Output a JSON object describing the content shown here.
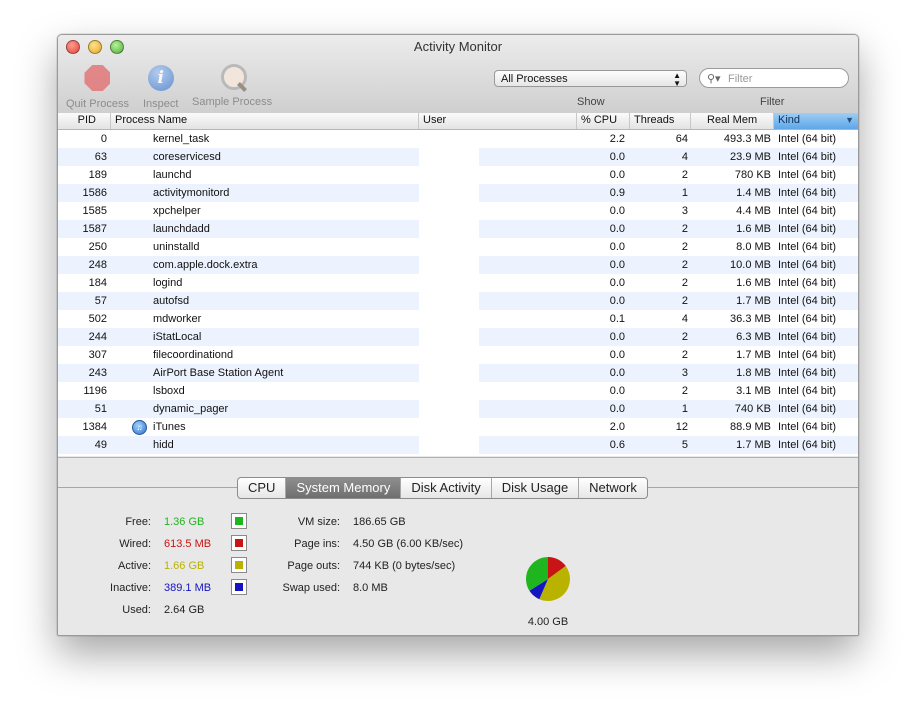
{
  "window": {
    "title": "Activity Monitor"
  },
  "toolbar": {
    "quit_label": "Quit Process",
    "inspect_label": "Inspect",
    "sample_label": "Sample Process",
    "show_select_value": "All Processes",
    "show_label": "Show",
    "filter_placeholder": "Filter",
    "filter_label": "Filter"
  },
  "columns": {
    "pid": "PID",
    "name": "Process Name",
    "user": "User",
    "cpu": "% CPU",
    "threads": "Threads",
    "mem": "Real Mem",
    "kind": "Kind"
  },
  "processes": [
    {
      "pid": "0",
      "name": "kernel_task",
      "user": "",
      "cpu": "2.2",
      "threads": "64",
      "mem": "493.3 MB",
      "kind": "Intel (64 bit)"
    },
    {
      "pid": "63",
      "name": "coreservicesd",
      "user": "",
      "cpu": "0.0",
      "threads": "4",
      "mem": "23.9 MB",
      "kind": "Intel (64 bit)"
    },
    {
      "pid": "189",
      "name": "launchd",
      "user": "",
      "cpu": "0.0",
      "threads": "2",
      "mem": "780 KB",
      "kind": "Intel (64 bit)"
    },
    {
      "pid": "1586",
      "name": "activitymonitord",
      "user": "",
      "cpu": "0.9",
      "threads": "1",
      "mem": "1.4 MB",
      "kind": "Intel (64 bit)"
    },
    {
      "pid": "1585",
      "name": "xpchelper",
      "user": "",
      "cpu": "0.0",
      "threads": "3",
      "mem": "4.4 MB",
      "kind": "Intel (64 bit)"
    },
    {
      "pid": "1587",
      "name": "launchdadd",
      "user": "",
      "cpu": "0.0",
      "threads": "2",
      "mem": "1.6 MB",
      "kind": "Intel (64 bit)"
    },
    {
      "pid": "250",
      "name": "uninstalld",
      "user": "",
      "cpu": "0.0",
      "threads": "2",
      "mem": "8.0 MB",
      "kind": "Intel (64 bit)"
    },
    {
      "pid": "248",
      "name": "com.apple.dock.extra",
      "user": "",
      "cpu": "0.0",
      "threads": "2",
      "mem": "10.0 MB",
      "kind": "Intel (64 bit)"
    },
    {
      "pid": "184",
      "name": "logind",
      "user": "",
      "cpu": "0.0",
      "threads": "2",
      "mem": "1.6 MB",
      "kind": "Intel (64 bit)"
    },
    {
      "pid": "57",
      "name": "autofsd",
      "user": "",
      "cpu": "0.0",
      "threads": "2",
      "mem": "1.7 MB",
      "kind": "Intel (64 bit)"
    },
    {
      "pid": "502",
      "name": "mdworker",
      "user": "",
      "cpu": "0.1",
      "threads": "4",
      "mem": "36.3 MB",
      "kind": "Intel (64 bit)"
    },
    {
      "pid": "244",
      "name": "iStatLocal",
      "user": "",
      "cpu": "0.0",
      "threads": "2",
      "mem": "6.3 MB",
      "kind": "Intel (64 bit)"
    },
    {
      "pid": "307",
      "name": "filecoordinationd",
      "user": "",
      "cpu": "0.0",
      "threads": "2",
      "mem": "1.7 MB",
      "kind": "Intel (64 bit)"
    },
    {
      "pid": "243",
      "name": "AirPort Base Station Agent",
      "user": "",
      "cpu": "0.0",
      "threads": "3",
      "mem": "1.8 MB",
      "kind": "Intel (64 bit)"
    },
    {
      "pid": "1196",
      "name": "lsboxd",
      "user": "",
      "cpu": "0.0",
      "threads": "2",
      "mem": "3.1 MB",
      "kind": "Intel (64 bit)"
    },
    {
      "pid": "51",
      "name": "dynamic_pager",
      "user": "",
      "cpu": "0.0",
      "threads": "1",
      "mem": "740 KB",
      "kind": "Intel (64 bit)"
    },
    {
      "pid": "1384",
      "name": "iTunes",
      "user": "",
      "cpu": "2.0",
      "threads": "12",
      "mem": "88.9 MB",
      "kind": "Intel (64 bit)",
      "icon": "itunes-icon"
    },
    {
      "pid": "49",
      "name": "hidd",
      "user": "",
      "cpu": "0.6",
      "threads": "5",
      "mem": "1.7 MB",
      "kind": "Intel (64 bit)"
    }
  ],
  "tabs": [
    "CPU",
    "System Memory",
    "Disk Activity",
    "Disk Usage",
    "Network"
  ],
  "active_tab": "System Memory",
  "memory": {
    "free_label": "Free:",
    "free_value": "1.36 GB",
    "free_color": "#1fb51f",
    "wired_label": "Wired:",
    "wired_value": "613.5 MB",
    "wired_color": "#c81414",
    "active_label": "Active:",
    "active_value": "1.66 GB",
    "active_color": "#b9b300",
    "inactive_label": "Inactive:",
    "inactive_value": "389.1 MB",
    "inactive_color": "#1414c0",
    "used_label": "Used:",
    "used_value": "2.64 GB",
    "vm_size_label": "VM size:",
    "vm_size_value": "186.65 GB",
    "page_ins_label": "Page ins:",
    "page_ins_value": "4.50 GB (6.00 KB/sec)",
    "page_outs_label": "Page outs:",
    "page_outs_value": "744 KB (0 bytes/sec)",
    "swap_label": "Swap used:",
    "swap_value": "8.0 MB",
    "total": "4.00 GB"
  }
}
